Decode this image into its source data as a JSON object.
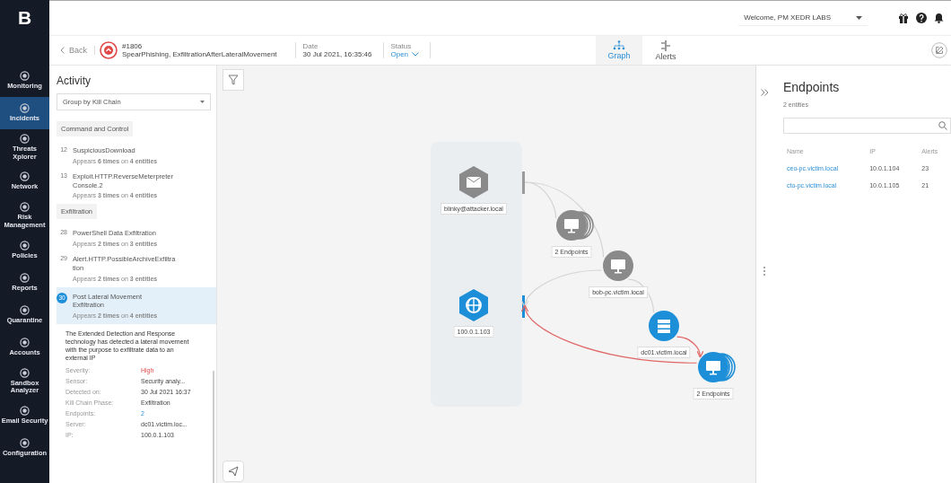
{
  "logo": "B",
  "user": {
    "welcome": "Welcome, PM XEDR LABS"
  },
  "nav": [
    {
      "label": "Monitoring",
      "selected": false
    },
    {
      "label": "Incidents",
      "selected": true
    },
    {
      "label": "Threats Xplorer",
      "selected": false
    },
    {
      "label": "Network",
      "selected": false
    },
    {
      "label": "Risk Management",
      "selected": false
    },
    {
      "label": "Policies",
      "selected": false
    },
    {
      "label": "Reports",
      "selected": false
    },
    {
      "label": "Quarantine",
      "selected": false
    },
    {
      "label": "Accounts",
      "selected": false
    },
    {
      "label": "Sandbox Analyzer",
      "selected": false
    },
    {
      "label": "Email Security",
      "selected": false
    },
    {
      "label": "Configuration",
      "selected": false
    }
  ],
  "incident": {
    "back": "Back",
    "number": "#1806",
    "name": "SpearPhishing, ExfiltrationAfterLateralMovement",
    "date_label": "Date",
    "date": "30 Jul 2021, 16:35:46",
    "status_label": "Status",
    "status": "Open"
  },
  "tabs": [
    {
      "label": "Graph",
      "selected": true
    },
    {
      "label": "Alerts",
      "selected": false
    }
  ],
  "activity": {
    "title": "Activity",
    "group_by": "Group by Kill Chain",
    "groups": [
      {
        "name": "Command and Control",
        "items": [
          {
            "number": "12",
            "name": "SuspiciousDownload",
            "summary": "Appears **6 times** on **4 entities**",
            "selected": false
          },
          {
            "number": "13",
            "name": "Exploit.HTTP.ReverseMeterpreter Console.2",
            "summary": "Appears **3 times** on **4 entities**",
            "selected": false
          }
        ]
      },
      {
        "name": "Exfiltration",
        "items": [
          {
            "number": "28",
            "name": "PowerShell Data Exfiltration",
            "summary": "Appears **2 times** on **3 entities**",
            "selected": false
          },
          {
            "number": "29",
            "name": "Alert.HTTP.PossibleArchiveExfiltra tion",
            "summary": "Appears **2 times** on **3 entities**",
            "selected": false
          },
          {
            "number": "30",
            "name": "Post Lateral Movement Exfiltration",
            "summary": "Appears **2 times** on **4 entities**",
            "selected": true
          }
        ]
      }
    ],
    "details": {
      "description": "The Extended Detection and Response technology has detected a lateral movement with the purpose to exfiltrate data to an external IP",
      "fields": [
        {
          "label": "Severity:",
          "value": "High",
          "kind": "severity"
        },
        {
          "label": "Sensor:",
          "value": "Security analy...",
          "kind": "text"
        },
        {
          "label": "Detected on:",
          "value": "30 Jul 2021 16:37",
          "kind": "text"
        },
        {
          "label": "Kill Chain Phase:",
          "value": "Exfiltration",
          "kind": "text"
        },
        {
          "label": "Endpoints:",
          "value": "2",
          "kind": "link"
        },
        {
          "label": "Server:",
          "value": "dc01.victim.loc...",
          "kind": "text"
        },
        {
          "label": "IP:",
          "value": "100.0.1.103",
          "kind": "text"
        }
      ]
    }
  },
  "graph": {
    "nodes": [
      {
        "kind": "email",
        "label": "blinky@attacker.local",
        "highlighted": false
      },
      {
        "kind": "endpoints",
        "label": "2 Endpoints",
        "highlighted": false
      },
      {
        "kind": "endpoint",
        "label": "bob-pc.victim.local",
        "highlighted": false
      },
      {
        "kind": "ip",
        "label": "100.0.1.103",
        "highlighted": true
      },
      {
        "kind": "server",
        "label": "dc01.victim.local",
        "highlighted": true
      },
      {
        "kind": "endpoints",
        "label": "2 Endpoints",
        "highlighted": true
      }
    ],
    "edges": [
      {
        "kind": "plain"
      },
      {
        "kind": "plain"
      },
      {
        "kind": "plain"
      },
      {
        "kind": "plain"
      },
      {
        "kind": "alert"
      },
      {
        "kind": "alert"
      }
    ]
  },
  "endpoints": {
    "title": "Endpoints",
    "count": "2 entities",
    "columns": [
      "Name",
      "IP",
      "Alerts"
    ],
    "rows": [
      [
        "ceo-pc.victim.local",
        "10.0.1.104",
        "23"
      ],
      [
        "cto-pc.victim.local",
        "10.0.1.105",
        "21"
      ]
    ]
  }
}
